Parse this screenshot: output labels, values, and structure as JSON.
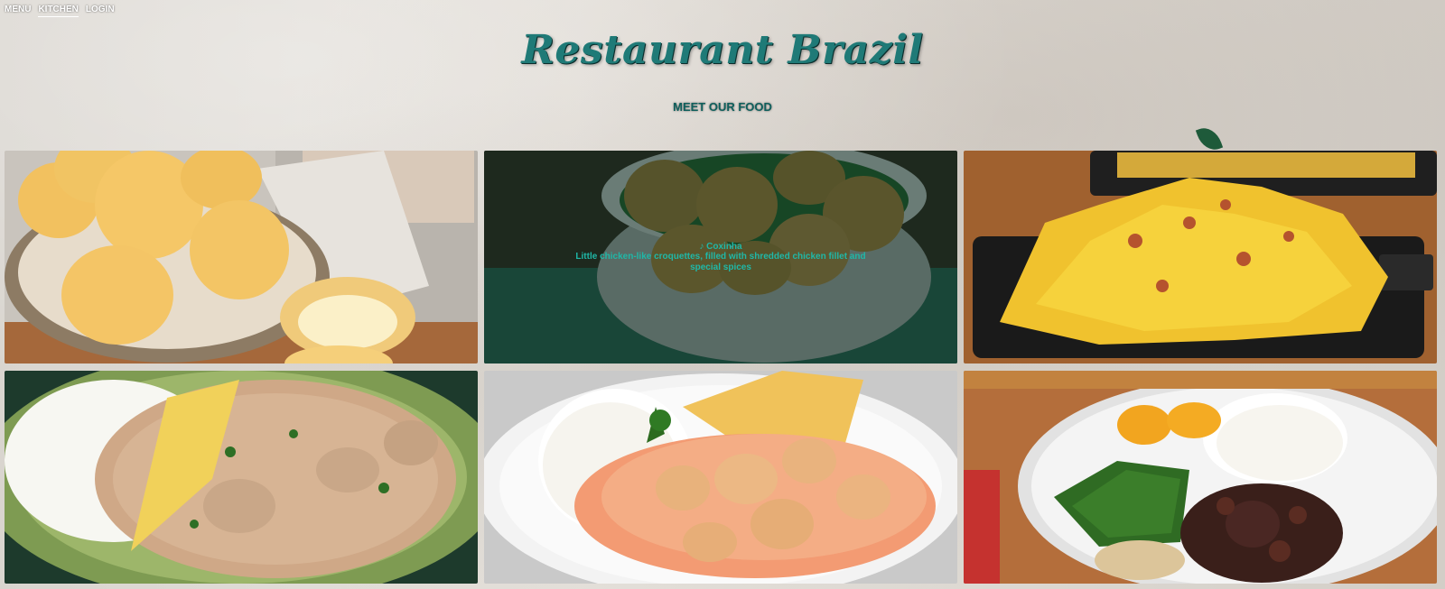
{
  "nav": {
    "menu": "MENU",
    "kitchen": "KITCHEN",
    "login": "LOGIN"
  },
  "header": {
    "title": "Restaurant Brazil",
    "subtitle": "MEET OUR FOOD"
  },
  "dishes": [
    {
      "image": "pao-de-queijo-photo"
    },
    {
      "image": "coxinha-photo",
      "overlay_icon": "music-note-icon",
      "title": "Coxinha",
      "description": "Little chicken-like croquettes, filled with shredded chicken fillet and special spices"
    },
    {
      "image": "cheese-bacon-fries-photo"
    },
    {
      "image": "stroganoff-green-plate-photo"
    },
    {
      "image": "chicken-stroganoff-white-plate-photo"
    },
    {
      "image": "feijoada-photo"
    }
  ],
  "colors": {
    "accent": "#1f7a77",
    "overlay_text": "#1fb8a8"
  }
}
